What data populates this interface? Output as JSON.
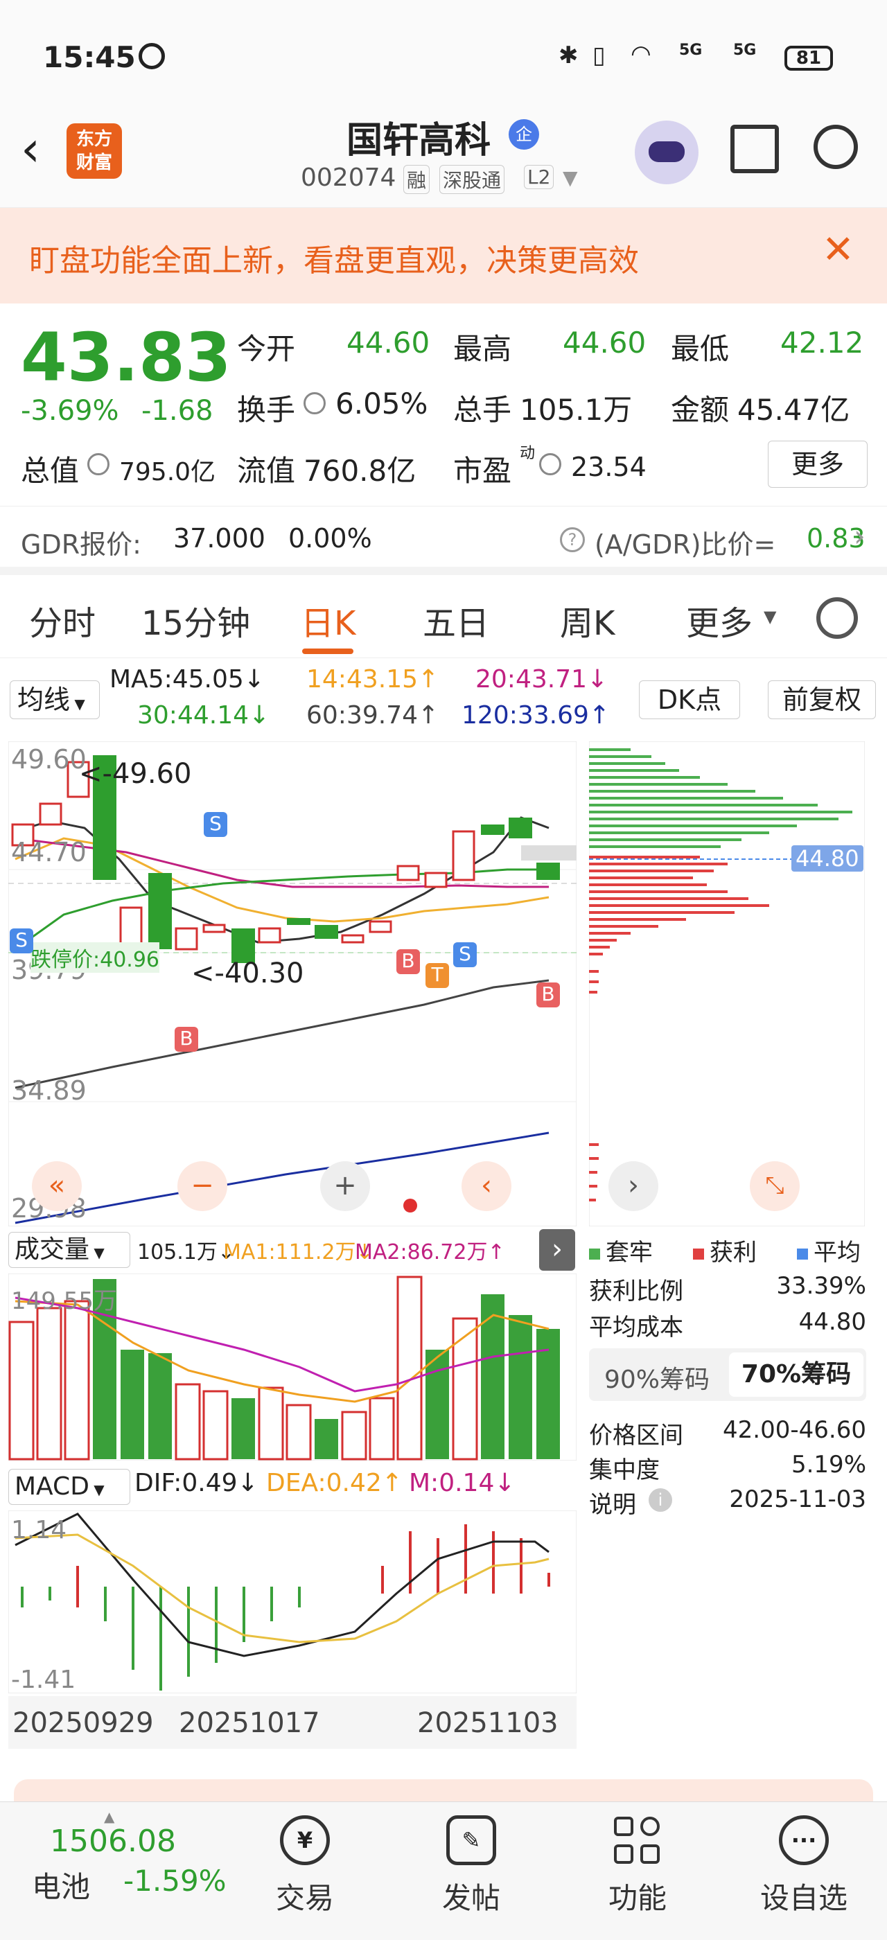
{
  "status": {
    "time": "15:45",
    "battery": "81",
    "signal1": "5G",
    "signal2": "5G"
  },
  "header": {
    "app_logo": "东方\n财富",
    "title": "国轩高科",
    "title_badge": "企",
    "code": "002074",
    "tag_rong": "融",
    "tag_sgt": "深股通",
    "tag_l2": "L2"
  },
  "banner": {
    "text": "盯盘功能全面上新，看盘更直观，决策更高效"
  },
  "quote": {
    "price": "43.83",
    "change_pct": "-3.69%",
    "change": "-1.68",
    "open_label": "今开",
    "open": "44.60",
    "high_label": "最高",
    "high": "44.60",
    "low_label": "最低",
    "low": "42.12",
    "turnover_label": "换手",
    "turnover": "6.05%",
    "volume_label": "总手",
    "volume": "105.1万",
    "amount_label": "金额",
    "amount": "45.47亿",
    "mcap_label": "总值",
    "mcap": "795.0亿",
    "float_label": "流值",
    "float_cap": "760.8亿",
    "pe_label": "市盈",
    "pe_sup": "动",
    "pe": "23.54",
    "more_btn": "更多"
  },
  "gdr": {
    "label": "GDR报价:",
    "price": "37.000",
    "pct": "0.00%",
    "ratio_label": "(A/GDR)比价=",
    "ratio": "0.83"
  },
  "tabs": [
    "分时",
    "15分钟",
    "日K",
    "五日",
    "周K",
    "更多"
  ],
  "ma_bar": {
    "selector": "均线",
    "ma5": "MA5:45.05↓",
    "ma14": "14:43.15↑",
    "ma20": "20:43.71↓",
    "ma30": "30:44.14↓",
    "ma60": "60:39.74↑",
    "ma120": "120:33.69↑",
    "dk_btn": "DK点",
    "fq_btn": "前复权"
  },
  "kchart": {
    "y_labels": [
      "49.60",
      "44.70",
      "39.79",
      "34.89",
      "29.98"
    ],
    "high_note": "<-49.60",
    "low_note": "<-40.30",
    "limit_label": "跌停价:40.96",
    "markers": [
      "S",
      "S",
      "B",
      "B",
      "T",
      "S",
      "B"
    ]
  },
  "chip": {
    "price_tag": "44.80",
    "legend": [
      "套牢",
      "获利",
      "平均"
    ],
    "profit_label": "获利比例",
    "profit": "33.39%",
    "cost_label": "平均成本",
    "cost": "44.80",
    "tab90": "90%筹码",
    "tab70": "70%筹码",
    "range_label": "价格区间",
    "range": "42.00-46.60",
    "conc_label": "集中度",
    "conc": "5.19%",
    "note_label": "说明",
    "note_date": "2025-11-03"
  },
  "volume_bar": {
    "selector": "成交量",
    "vol": "105.1万↓",
    "ma1": "MA1:111.2万↓",
    "ma2": "MA2:86.72万↑",
    "y_top": "149.55万"
  },
  "macd_bar": {
    "selector": "MACD",
    "dif": "DIF:0.49↓",
    "dea": "DEA:0.42↑",
    "m": "M:0.14↓",
    "y_top": "1.14",
    "y_bot": "-1.41"
  },
  "dates": [
    "20250929",
    "20251017",
    "20251103"
  ],
  "bottom_nav": {
    "index_value": "1506.08",
    "index_name": "电池",
    "index_pct": "-1.59%",
    "items": [
      "交易",
      "发帖",
      "功能",
      "设自选"
    ]
  },
  "colors": {
    "up": "#d43030",
    "down": "#2e9e2e",
    "accent": "#e8601c"
  }
}
